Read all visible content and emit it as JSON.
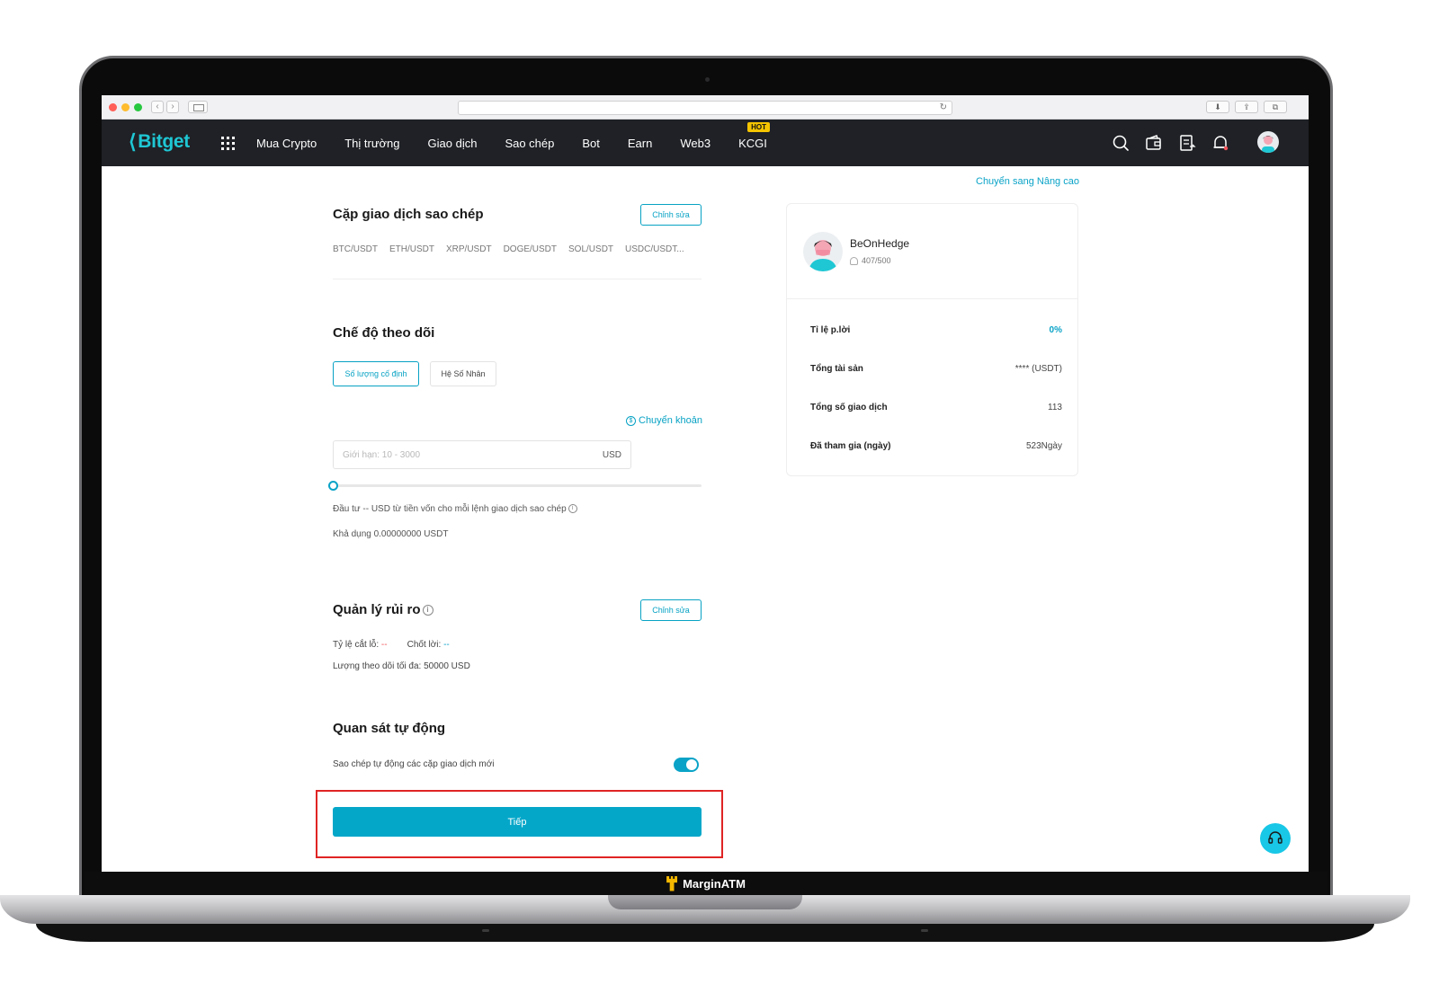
{
  "browser": {
    "colors": {
      "close": "#ff5f57",
      "minimize": "#febc2e",
      "zoom": "#28c840"
    },
    "back_glyph": "‹",
    "forward_glyph": "›",
    "reload_glyph": "↻",
    "download_glyph": "⬇",
    "share_glyph": "⇪",
    "tabs_glyph": "⧉"
  },
  "header": {
    "logo_mark": "⟨",
    "logo_text": "Bitget",
    "menu": [
      {
        "label": "Mua Crypto"
      },
      {
        "label": "Thị trường"
      },
      {
        "label": "Giao dịch"
      },
      {
        "label": "Sao chép"
      },
      {
        "label": "Bot"
      },
      {
        "label": "Earn"
      },
      {
        "label": "Web3"
      },
      {
        "label": "KCGI",
        "badge": "HOT"
      }
    ],
    "icons": [
      "search-icon",
      "wallet-icon",
      "orders-icon",
      "bell-icon",
      "avatar"
    ]
  },
  "advanced_link": "Chuyển sang Nâng cao",
  "copy_pairs": {
    "title": "Cặp giao dịch sao chép",
    "edit_label": "Chỉnh sửa",
    "pairs": [
      "BTC/USDT",
      "ETH/USDT",
      "XRP/USDT",
      "DOGE/USDT",
      "SOL/USDT",
      "USDC/USDT..."
    ]
  },
  "follow_mode": {
    "title": "Chế độ theo dõi",
    "options": [
      "Số lượng cố định",
      "Hệ Số Nhân"
    ],
    "selected": "Số lượng cố định",
    "transfer_link": "Chuyển khoản",
    "input_placeholder": "Giới hạn: 10 - 3000",
    "input_unit": "USD",
    "slider_value": 0,
    "invest_text": "Đầu tư -- USD từ tiền vốn cho mỗi lệnh giao dịch sao chép",
    "available_text": "Khả dụng 0.00000000 USDT"
  },
  "risk": {
    "title": "Quản lý rủi ro",
    "edit_label": "Chỉnh sửa",
    "stop_loss_label": "Tỷ lệ cắt lỗ:",
    "stop_loss_value": "--",
    "take_profit_label": "Chốt lời:",
    "take_profit_value": "--",
    "max_follow_text": "Lượng theo dõi tối đa: 50000 USD"
  },
  "auto_watch": {
    "title": "Quan sát tự động",
    "toggle_label": "Sao chép tự động các cặp giao dịch mới",
    "toggle_on": true
  },
  "next_button": "Tiếp",
  "trader": {
    "name": "BeOnHedge",
    "followers": "407/500",
    "stats": [
      {
        "label": "Tỉ lệ p.lời",
        "value": "0%",
        "accent": true
      },
      {
        "label": "Tổng tài sản",
        "value": "**** (USDT)"
      },
      {
        "label": "Tổng số giao dịch",
        "value": "113"
      },
      {
        "label": "Đã tham gia (ngày)",
        "value": "523Ngày"
      }
    ]
  },
  "footer_brand": "MarginATM",
  "accent_color": "#07a2c4"
}
